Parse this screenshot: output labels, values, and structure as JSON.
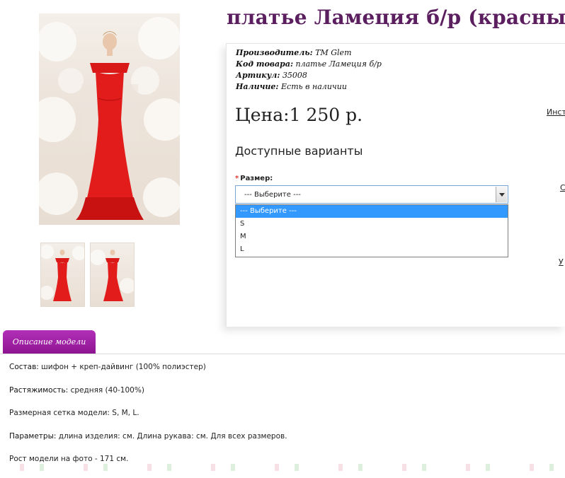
{
  "product": {
    "title": "платье Ламеция б/р (красный)"
  },
  "meta": {
    "manufacturer_label": "Производитель:",
    "manufacturer_value": "TM Glem",
    "code_label": "Код товара:",
    "code_value": "платье Ламеция б/р",
    "sku_label": "Артикул:",
    "sku_value": "35008",
    "stock_label": "Наличие:",
    "stock_value": "Есть в наличии"
  },
  "price": {
    "text": "Цена:1 250 р."
  },
  "variants": {
    "title": "Доступные варианты",
    "size_label": "Размер:",
    "required_mark": "*",
    "selected": "--- Выберите ---",
    "options": [
      "--- Выберите ---",
      "S",
      "M",
      "L"
    ]
  },
  "side_links": {
    "instr": "Инст",
    "c": "С",
    "y": "У"
  },
  "tabs": {
    "description": "Описание модели"
  },
  "description": {
    "composition_label": "Состав:",
    "composition_value": "шифон + креп-дайвинг (100% полиэстер)",
    "stretch_label": "Растяжимость:",
    "stretch_value": "средняя (40-100%)",
    "sizes_text": "Размерная сетка модели: S, M, L.",
    "params_label": "Параметры:",
    "params_value": "длина изделия:  см. Длина рукава:  см. Для всех размеров.",
    "height_text": "Рост модели на фото - 171 см."
  },
  "colors": {
    "title": "#5b1f5f",
    "tab": "#9c1fa1",
    "dress": "#e21b1b",
    "select_highlight": "#3399ff"
  }
}
